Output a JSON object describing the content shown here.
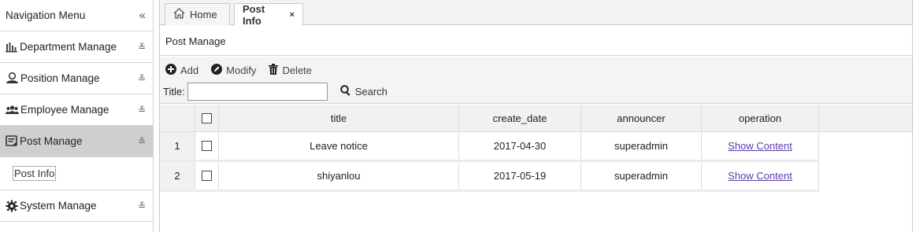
{
  "sidebar": {
    "title": "Navigation Menu",
    "collapse_icon": "double-chevron-left-icon",
    "sections": [
      {
        "label": "Department Manage",
        "icon": "bar-chart-icon",
        "chevron": "chevron-down-icon"
      },
      {
        "label": "Position Manage",
        "icon": "user-icon",
        "chevron": "chevron-down-icon"
      },
      {
        "label": "Employee Manage",
        "icon": "users-icon",
        "chevron": "chevron-down-icon"
      },
      {
        "label": "Post Manage",
        "icon": "post-icon",
        "chevron": "chevron-up-icon",
        "active": true
      },
      {
        "label": "System Manage",
        "icon": "gear-icon",
        "chevron": "chevron-down-icon"
      }
    ],
    "sub_items": [
      {
        "label": "Post Info"
      }
    ]
  },
  "tabs": [
    {
      "label": "Home",
      "icon": "home-icon"
    },
    {
      "label": "Post Info",
      "close": "×",
      "active": true
    }
  ],
  "panel": {
    "title": "Post Manage"
  },
  "toolbar": {
    "add_label": "Add",
    "modify_label": "Modify",
    "delete_label": "Delete",
    "title_label": "Title:",
    "title_value": "",
    "search_label": "Search"
  },
  "table": {
    "columns": [
      "title",
      "create_date",
      "announcer",
      "operation"
    ],
    "rows": [
      {
        "index": "1",
        "title": "Leave notice",
        "create_date": "2017-04-30",
        "announcer": "superadmin",
        "operation": "Show Content"
      },
      {
        "index": "2",
        "title": "shiyanlou",
        "create_date": "2017-05-19",
        "announcer": "superadmin",
        "operation": "Show Content"
      }
    ]
  },
  "colors": {
    "active_section_bg": "#cfcfcf",
    "link": "#5b3ea8"
  }
}
